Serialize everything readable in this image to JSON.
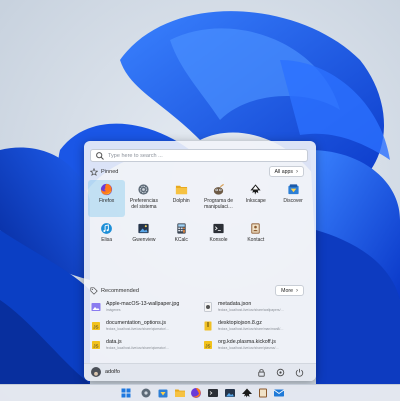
{
  "search": {
    "placeholder": "Type here to search ..."
  },
  "pinned": {
    "title": "Pinned",
    "all_apps_label": "All apps",
    "rows": [
      [
        {
          "label": "Firefox",
          "icon": "firefox-icon",
          "active": true
        },
        {
          "label": "Preferencias del sistema",
          "icon": "system-settings-icon"
        },
        {
          "label": "Dolphin",
          "icon": "dolphin-folder-icon"
        },
        {
          "label": "Programa de manipulaci…",
          "icon": "gimp-icon"
        },
        {
          "label": "Inkscape",
          "icon": "inkscape-icon"
        },
        {
          "label": "Discover",
          "icon": "discover-icon"
        }
      ],
      [
        {
          "label": "Elisa",
          "icon": "elisa-icon"
        },
        {
          "label": "Gwenview",
          "icon": "gwenview-icon"
        },
        {
          "label": "KCalc",
          "icon": "kcalc-icon"
        },
        {
          "label": "Konsole",
          "icon": "konsole-icon"
        },
        {
          "label": "Kontact",
          "icon": "kontact-icon"
        }
      ]
    ]
  },
  "recommended": {
    "title": "Recommended",
    "more_label": "More",
    "items": [
      {
        "title": "Apple-macOS-13-wallpaper.jpg",
        "sub": "Imágenes",
        "icon": "image-file-icon"
      },
      {
        "title": "metadata.json",
        "sub": "fedora_localhost-live/usr/share/wallpapers/…",
        "icon": "json-file-icon"
      },
      {
        "title": "documentation_options.js",
        "sub": "fedora_localhost-live/usr/share/qtcreator/…",
        "icon": "js-file-icon"
      },
      {
        "title": "desktopiojson.8.gz",
        "sub": "fedora_localhost-live/usr/share/man/man8/…",
        "icon": "archive-file-icon"
      },
      {
        "title": "data.js",
        "sub": "fedora_localhost-live/usr/share/qtcreator/…",
        "icon": "js-file-icon"
      },
      {
        "title": "org.kde.plasma.kickoff.js",
        "sub": "fedora_localhost-live/usr/share/plasma/…",
        "icon": "js-file-icon"
      }
    ]
  },
  "user": {
    "name": "adolfo"
  },
  "colors": {
    "accent": "#3daee9",
    "wallpaper": "#1d5ee6"
  }
}
